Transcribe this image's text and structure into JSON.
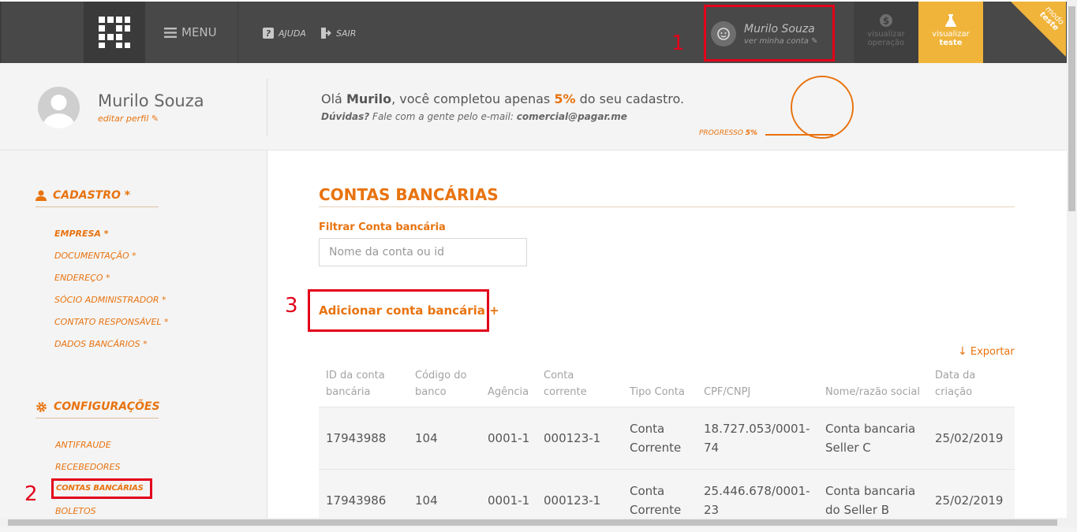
{
  "topbar": {
    "menu_label": "MENU",
    "help_label": "AJUDA",
    "logout_label": "SAIR",
    "user_name": "Murilo Souza",
    "user_sub": "ver minha conta",
    "view_op_line1": "visualizar",
    "view_op_line2": "operação",
    "view_test_line1": "visualizar",
    "view_test_line2": "teste",
    "mode_line1": "modo",
    "mode_line2": "teste"
  },
  "profile": {
    "name": "Murilo Souza",
    "edit_label": "editar perfil",
    "greeting_pre": "Olá ",
    "greeting_name": "Murilo",
    "greeting_mid": ", você completou apenas ",
    "greeting_pct": "5%",
    "greeting_post": " do seu cadastro.",
    "doubts_pre": "Dúvidas?",
    "doubts_mid": " Fale com a gente pelo e-mail: ",
    "doubts_email": "comercial@pagar.me",
    "progress_label": "PROGRESSO",
    "progress_pct": "5%",
    "progress_value": 0.05
  },
  "sidebar": {
    "cadastro_title": "CADASTRO *",
    "cadastro_items": [
      "EMPRESA  *",
      "DOCUMENTAÇÃO  *",
      "ENDEREÇO  *",
      "SÓCIO ADMINISTRADOR  *",
      "CONTATO RESPONSÁVEL  *",
      "DADOS BANCÁRIOS  *"
    ],
    "config_title": "CONFIGURAÇÕES",
    "config_items": [
      "ANTIFRAUDE",
      "RECEBEDORES",
      "CONTAS BANCÁRIAS",
      "BOLETOS"
    ]
  },
  "annotations": {
    "n1": "1",
    "n2": "2",
    "n3": "3"
  },
  "main": {
    "title": "CONTAS BANCÁRIAS",
    "filter_label": "Filtrar Conta bancária",
    "filter_placeholder": "Nome da conta ou id",
    "add_label": "Adicionar conta bancária +",
    "export_label": "Exportar",
    "table": {
      "headers": [
        [
          "ID da conta",
          "bancária"
        ],
        [
          "Código do",
          "banco"
        ],
        [
          "",
          "Agência"
        ],
        [
          "Conta",
          "corrente"
        ],
        [
          "",
          "Tipo Conta"
        ],
        [
          "",
          "CPF/CNPJ"
        ],
        [
          "",
          "Nome/razão social"
        ],
        [
          "Data da",
          "criação"
        ]
      ],
      "rows": [
        {
          "id": "17943988",
          "bank": "104",
          "agency": "0001-1",
          "account": "000123-1",
          "type1": "Conta",
          "type2": "Corrente",
          "doc1": "18.727.053/0001-",
          "doc2": "74",
          "name1": "Conta bancaria",
          "name2": "Seller C",
          "date": "25/02/2019"
        },
        {
          "id": "17943986",
          "bank": "104",
          "agency": "0001-1",
          "account": "000123-1",
          "type1": "Conta",
          "type2": "Corrente",
          "doc1": "25.446.678/0001-",
          "doc2": "23",
          "name1": "Conta bancaria",
          "name2": "do Seller B",
          "date": "25/02/2019"
        }
      ]
    }
  }
}
